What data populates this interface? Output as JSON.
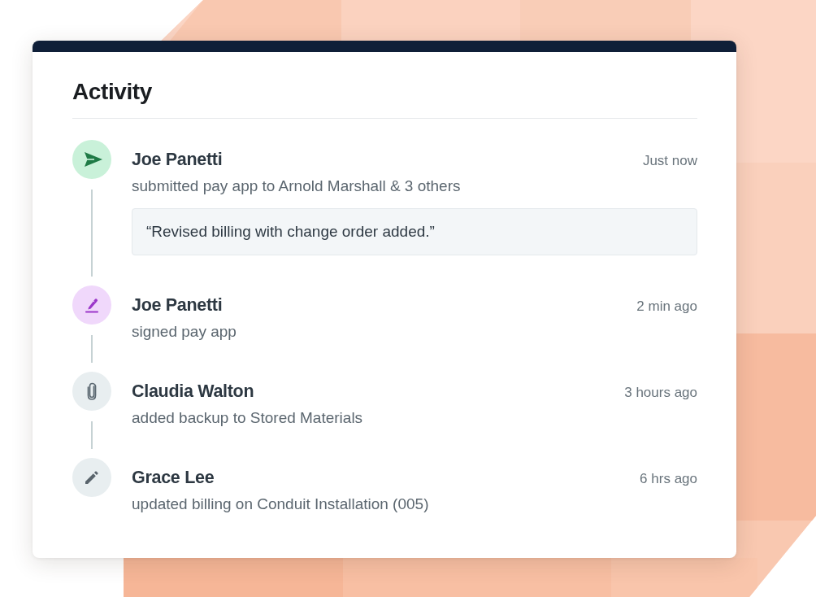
{
  "panel": {
    "title": "Activity"
  },
  "activities": [
    {
      "kind": "send",
      "name": "Joe Panetti",
      "time": "Just now",
      "action": "submitted pay app to Arnold Marshall & 3 others",
      "note": "“Revised billing with change order added.”"
    },
    {
      "kind": "sign",
      "name": "Joe Panetti",
      "time": "2 min ago",
      "action": "signed pay app"
    },
    {
      "kind": "attach",
      "name": "Claudia Walton",
      "time": "3 hours ago",
      "action": "added backup to Stored Materials"
    },
    {
      "kind": "edit",
      "name": "Grace Lee",
      "time": "6 hrs ago",
      "action": "updated billing on Conduit Installation (005)"
    }
  ]
}
